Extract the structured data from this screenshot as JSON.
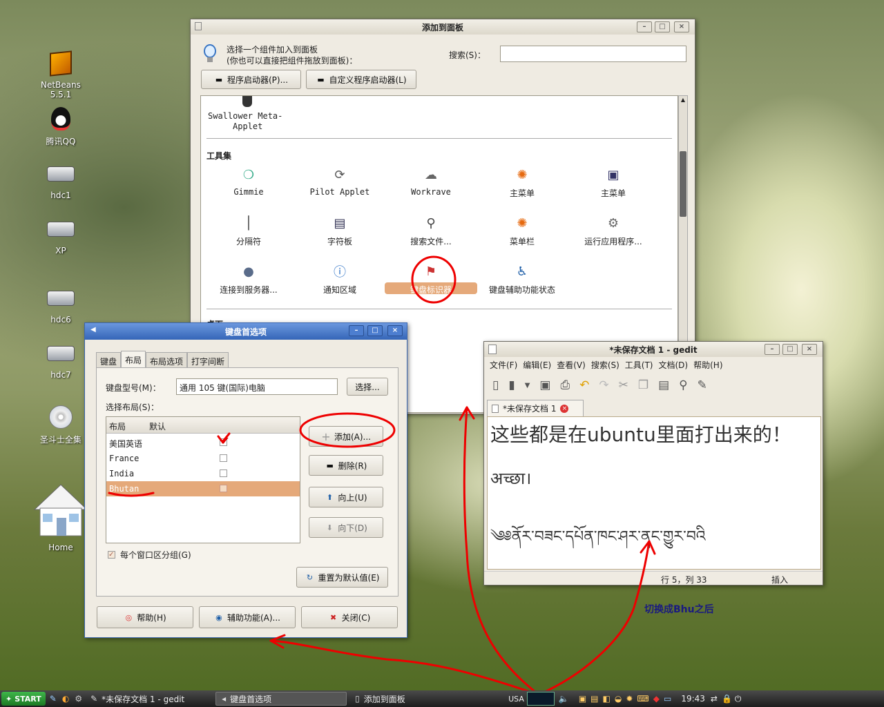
{
  "desktop": {
    "icons": [
      {
        "label": "NetBeans 5.5.1",
        "icon": "netbeans-icon"
      },
      {
        "label": "腾讯QQ",
        "icon": "qq-penguin-icon"
      },
      {
        "label": "hdc1",
        "icon": "drive-icon"
      },
      {
        "label": "XP",
        "icon": "drive-icon"
      },
      {
        "label": "hdc6",
        "icon": "drive-icon"
      },
      {
        "label": "hdc7",
        "icon": "drive-icon"
      },
      {
        "label": "圣斗士全集",
        "icon": "dvd-icon"
      },
      {
        "label": "Home",
        "icon": "home-icon"
      }
    ]
  },
  "add_panel": {
    "title": "添加到面板",
    "hint_line1": "选择一个组件加入到面板",
    "hint_line2": "(你也可以直接把组件拖放到面板)：",
    "search_label": "搜索(S)：",
    "search_value": "",
    "launcher_btn": "程序启动器(P)...",
    "custom_launcher_btn": "自定义程序启动器(L)",
    "swallower_line1": "Swallower Meta-",
    "swallower_line2": "Applet",
    "section_tools": "工具集",
    "section_next": "桌面",
    "tools": [
      {
        "label": "Gimmie",
        "icon": "gimmie-icon"
      },
      {
        "label": "Pilot Applet",
        "icon": "pilot-icon"
      },
      {
        "label": "Workrave",
        "icon": "sheep-icon"
      },
      {
        "label": "主菜单",
        "icon": "ubuntu-menu-icon"
      },
      {
        "label": "主菜单",
        "icon": "computer-icon"
      },
      {
        "label": "分隔符",
        "icon": "separator-icon"
      },
      {
        "label": "字符板",
        "icon": "charpick-icon"
      },
      {
        "label": "搜索文件...",
        "icon": "magnifier-icon"
      },
      {
        "label": "菜单栏",
        "icon": "ubuntu-menubar-icon"
      },
      {
        "label": "运行应用程序...",
        "icon": "run-gear-icon"
      },
      {
        "label": "连接到服务器...",
        "icon": "server-globe-icon"
      },
      {
        "label": "通知区域",
        "icon": "info-icon"
      },
      {
        "label": "键盘标识器",
        "icon": "keyboard-flag-icon"
      },
      {
        "label": "键盘辅助功能状态",
        "icon": "accessibility-icon"
      }
    ]
  },
  "kbd_prefs": {
    "title": "键盘首选项",
    "tabs": [
      "键盘",
      "布局",
      "布局选项",
      "打字间断"
    ],
    "active_tab": "布局",
    "model_label": "键盘型号(M)：",
    "model_value": "通用 105 键(国际)电脑",
    "select_btn": "选择...",
    "layouts_label": "选择布局(S)：",
    "col_layout": "布局",
    "col_default": "默认",
    "layouts": [
      {
        "name": "美国英语",
        "default": true
      },
      {
        "name": "France",
        "default": false
      },
      {
        "name": "India",
        "default": false
      },
      {
        "name": "Bhutan",
        "default": false
      }
    ],
    "add_btn": "添加(A)...",
    "remove_btn": "删除(R)",
    "up_btn": "向上(U)",
    "down_btn": "向下(D)",
    "group_check": "每个窗口区分组(G)",
    "reset_btn": "重置为默认值(E)",
    "help_btn": "帮助(H)",
    "access_btn": "辅助功能(A)...",
    "close_btn": "关闭(C)"
  },
  "gedit": {
    "title": "*未保存文档 1 - gedit",
    "menus": [
      "文件(F)",
      "编辑(E)",
      "查看(V)",
      "搜索(S)",
      "工具(T)",
      "文档(D)",
      "帮助(H)"
    ],
    "tab_label": "*未保存文档 1",
    "line1": "这些都是在ubuntu里面打出来的！",
    "line2": "अच्छा।",
    "line3": "༄༅ནོར་བཟང་དཔོན་ཁང་ཤར་ནང་གྱུར་བའི",
    "status_pos": "行 5，列 33",
    "status_mode": "插入"
  },
  "annotation": {
    "text": "切换成Bhu之后",
    "color": "#ff0000"
  },
  "taskbar": {
    "start": "START",
    "tasks": [
      "*未保存文档 1 - gedit",
      "键盘首选项",
      "添加到面板"
    ],
    "indicator": "USA",
    "clock": "19:43"
  }
}
